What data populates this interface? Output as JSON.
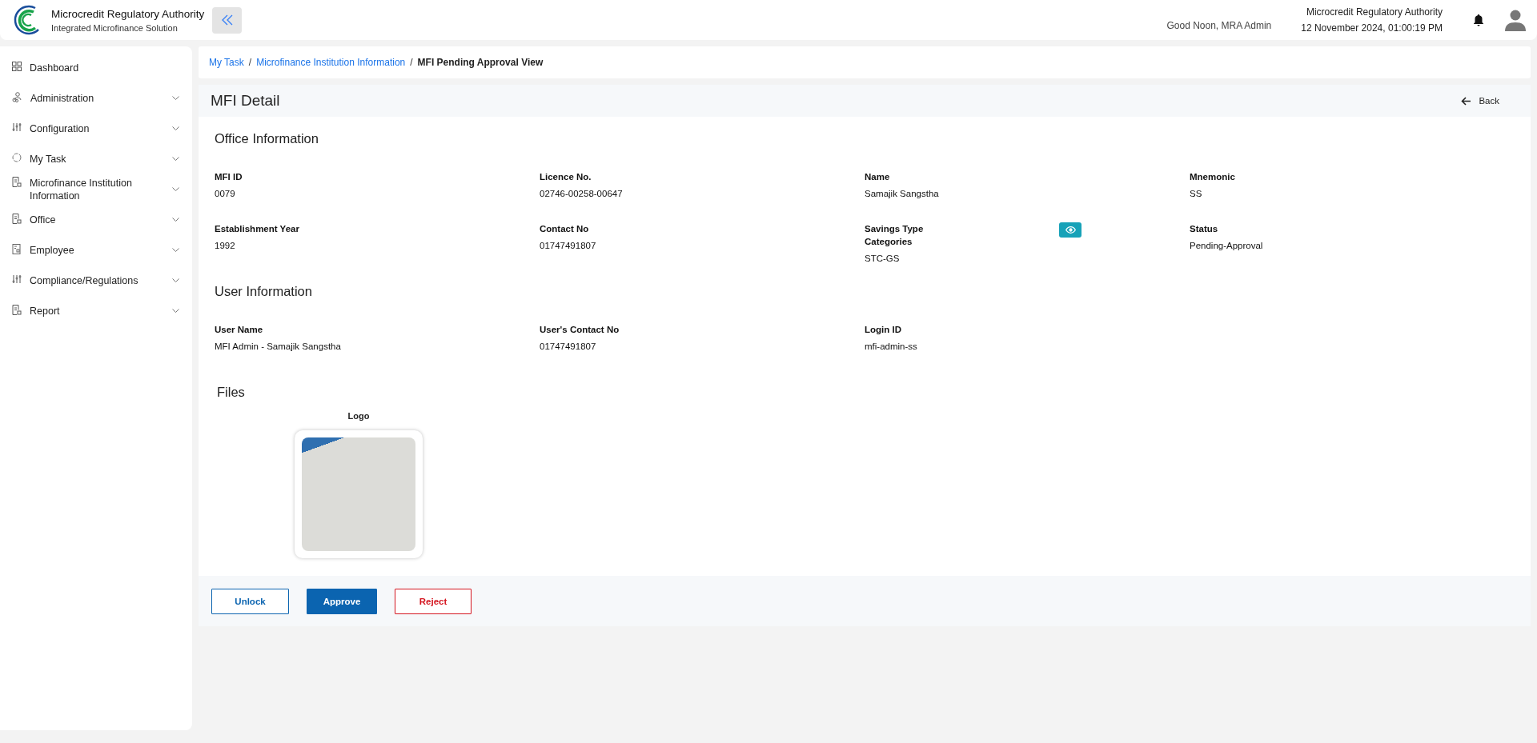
{
  "header": {
    "title": "Microcredit Regulatory Authority",
    "subtitle": "Integrated Microfinance Solution",
    "greeting": "Good Noon, MRA Admin",
    "org": "Microcredit Regulatory Authority",
    "datetime": "12 November 2024, 01:00:19 PM"
  },
  "sidebar": {
    "items": [
      {
        "label": "Dashboard",
        "kind": "grid",
        "expandable": false
      },
      {
        "label": "Administration",
        "kind": "users",
        "expandable": true
      },
      {
        "label": "Configuration",
        "kind": "sliders",
        "expandable": true
      },
      {
        "label": "My Task",
        "kind": "circle",
        "expandable": true
      },
      {
        "label": "Microfinance Institution Information",
        "kind": "doc",
        "expandable": true
      },
      {
        "label": "Office",
        "kind": "doc",
        "expandable": true
      },
      {
        "label": "Employee",
        "kind": "doc2",
        "expandable": true
      },
      {
        "label": "Compliance/Regulations",
        "kind": "sliders",
        "expandable": true
      },
      {
        "label": "Report",
        "kind": "doc",
        "expandable": true
      }
    ]
  },
  "breadcrumb": [
    {
      "label": "My Task",
      "kind": "link"
    },
    {
      "label": "/",
      "kind": "separator"
    },
    {
      "label": "Microfinance Institution Information",
      "kind": "link"
    },
    {
      "label": "/",
      "kind": "separator"
    },
    {
      "label": "MFI Pending Approval View",
      "kind": "current"
    }
  ],
  "page": {
    "title": "MFI Detail",
    "back": "Back"
  },
  "sections": [
    {
      "title": "Office Information",
      "fields": [
        {
          "label": "MFI ID",
          "value": "0079",
          "view_button": false
        },
        {
          "label": "Licence No.",
          "value": "02746-00258-00647",
          "view_button": false
        },
        {
          "label": "Name",
          "value": "Samajik Sangstha",
          "view_button": false
        },
        {
          "label": "Mnemonic",
          "value": "SS",
          "view_button": false
        },
        {
          "label": "Establishment Year",
          "value": "1992",
          "view_button": false
        },
        {
          "label": "Contact No",
          "value": "01747491807",
          "view_button": false
        },
        {
          "label": "Savings Type Categories",
          "value": "STC-GS",
          "view_button": true
        },
        {
          "label": "Status",
          "value": "Pending-Approval",
          "view_button": false
        }
      ]
    },
    {
      "title": "User Information",
      "fields": [
        {
          "label": "User Name",
          "value": "MFI Admin - Samajik Sangstha",
          "view_button": false
        },
        {
          "label": "User's Contact No",
          "value": "01747491807",
          "view_button": false
        },
        {
          "label": "Login ID",
          "value": "mfi-admin-ss",
          "view_button": false
        }
      ]
    }
  ],
  "files": {
    "title": "Files",
    "items": [
      {
        "label": "Logo"
      }
    ]
  },
  "actions": [
    {
      "label": "Unlock",
      "kind": "outline"
    },
    {
      "label": "Approve",
      "kind": "primary"
    },
    {
      "label": "Reject",
      "kind": "danger"
    }
  ]
}
